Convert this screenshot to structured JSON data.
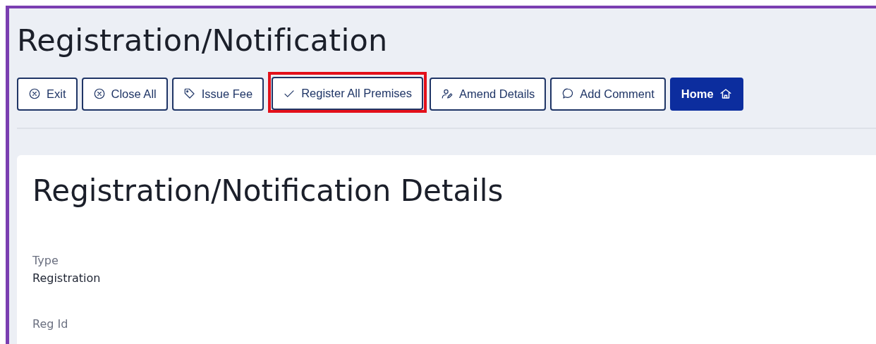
{
  "page_title": "Registration/Notification",
  "buttons": [
    {
      "label": "Exit",
      "kind": "outline",
      "highlighted": false
    },
    {
      "label": "Close All",
      "kind": "outline",
      "highlighted": false
    },
    {
      "label": "Issue Fee",
      "kind": "outline",
      "highlighted": false
    },
    {
      "label": "Register All Premises",
      "kind": "outline",
      "highlighted": true
    },
    {
      "label": "Amend Details",
      "kind": "outline",
      "highlighted": false
    },
    {
      "label": "Add Comment",
      "kind": "outline",
      "highlighted": false
    },
    {
      "label": "Home",
      "kind": "primary",
      "highlighted": false
    }
  ],
  "card": {
    "title": "Registration/Notification Details",
    "fields": [
      {
        "label": "Type",
        "value": "Registration"
      },
      {
        "label": "Reg Id"
      }
    ]
  }
}
